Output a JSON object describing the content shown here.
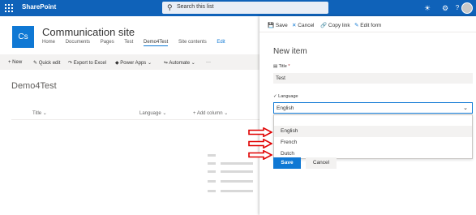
{
  "suitebar": {
    "brand": "SharePoint",
    "search_placeholder": "Search this list",
    "color": "#0f62b9"
  },
  "site": {
    "logo_initials": "Cs",
    "title": "Communication site",
    "nav": [
      "Home",
      "Documents",
      "Pages",
      "Test",
      "Demo4Test",
      "Site contents",
      "Edit"
    ]
  },
  "list_commands": [
    "New",
    "Quick edit",
    "Export to Excel",
    "Power Apps",
    "Automate",
    "···"
  ],
  "list": {
    "title": "Demo4Test",
    "columns": [
      "Title",
      "Language",
      "+ Add column"
    ]
  },
  "panel": {
    "commands": [
      "Save",
      "Cancel",
      "Copy link",
      "Edit form"
    ],
    "heading": "New item",
    "title_label": "Title",
    "title_required": "*",
    "title_value": "Test",
    "language_label": "Language",
    "language_value": "English",
    "options": [
      "English",
      "French",
      "Dutch"
    ],
    "save_label": "Save",
    "cancel_label": "Cancel"
  },
  "colors": {
    "accent": "#0f78d4",
    "arrow": "#e00000"
  }
}
